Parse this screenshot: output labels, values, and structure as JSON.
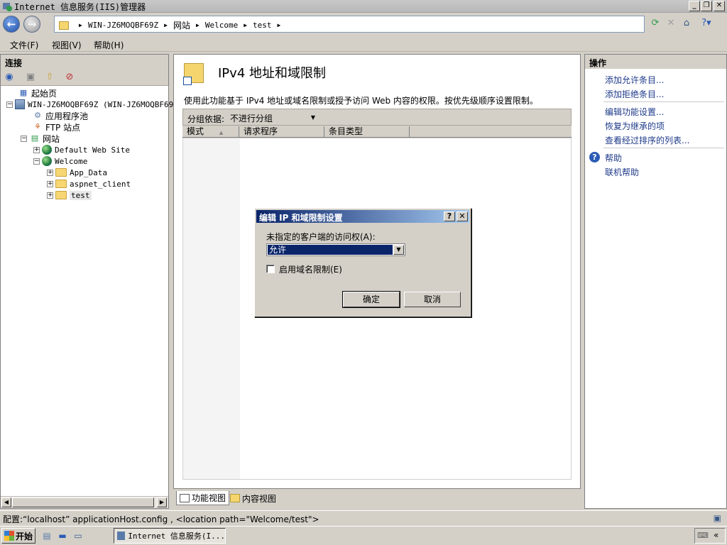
{
  "window": {
    "title": "Internet 信息服务(IIS)管理器",
    "buttons": {
      "minimize": "_",
      "restore": "❐",
      "close": "✕"
    }
  },
  "address": {
    "crumbs": [
      "WIN-JZ6MOQBF69Z",
      "网站",
      "Welcome",
      "test"
    ]
  },
  "menu": {
    "items": [
      "文件(F)",
      "视图(V)",
      "帮助(H)"
    ]
  },
  "connections": {
    "header": "连接",
    "tree": {
      "start_page": "起始页",
      "server": "WIN-JZ6MOQBF69Z (WIN-JZ6MOQBF69Z",
      "app_pools": "应用程序池",
      "ftp_sites": "FTP 站点",
      "sites": "网站",
      "default_site": "Default Web Site",
      "welcome": "Welcome",
      "app_data": "App_Data",
      "aspnet_client": "aspnet_client",
      "test": "test"
    }
  },
  "main": {
    "title": "IPv4 地址和域限制",
    "description": "使用此功能基于 IPv4 地址或域名限制或授予访问 Web 内容的权限。按优先级顺序设置限制。",
    "group_by_label": "分组依据:",
    "group_by_value": "不进行分组",
    "columns": [
      "模式",
      "请求程序",
      "条目类型"
    ],
    "sort_indicator": "▲"
  },
  "view_tabs": {
    "features": "功能视图",
    "content": "内容视图"
  },
  "actions": {
    "header": "操作",
    "add_allow": "添加允许条目...",
    "add_deny": "添加拒绝条目...",
    "edit_settings": "编辑功能设置...",
    "revert": "恢复为继承的项",
    "view_ordered": "查看经过排序的列表...",
    "help": "帮助",
    "online_help": "联机帮助"
  },
  "status": {
    "text": "配置:“localhost” applicationHost.config , <location path=\"Welcome/test\">"
  },
  "taskbar": {
    "start": "开始",
    "task_iis": "Internet 信息服务(I..."
  },
  "dialog": {
    "title": "编辑 IP 和域限制设置",
    "help_btn": "?",
    "close_btn": "✕",
    "access_label": "未指定的客户端的访问权(A):",
    "access_value": "允许",
    "domain_check_label": "启用域名限制(E)",
    "domain_checked": false,
    "ok": "确定",
    "cancel": "取消"
  },
  "colors": {
    "link": "#1e3a8a",
    "dialog_title_start": "#0a246a",
    "dialog_title_end": "#a6caf0",
    "chrome": "#d4d0c8"
  }
}
